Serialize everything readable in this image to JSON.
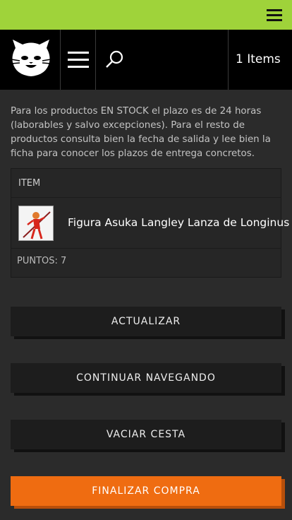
{
  "header": {
    "cart_label": "1 Items"
  },
  "notice": "Para los productos EN STOCK el plazo es de 24 horas (laborables y salvo excepciones). Para el resto de productos consulta bien la fecha de salida y lee bien la ficha para conocer los plazos de entrega concretos.",
  "cart_table": {
    "column_header": "ITEM",
    "items": [
      {
        "name": "Figura Asuka Langley Lanza de Longinus"
      }
    ],
    "points": "PUNTOS: 7"
  },
  "buttons": {
    "update": "ACTUALIZAR",
    "continue": "CONTINUAR NAVEGANDO",
    "empty": "VACIAR CESTA",
    "checkout": "FINALIZAR COMPRA"
  },
  "colors": {
    "topbar": "#9fd33a",
    "accent": "#ef6c11",
    "background": "#2b2b2b"
  }
}
